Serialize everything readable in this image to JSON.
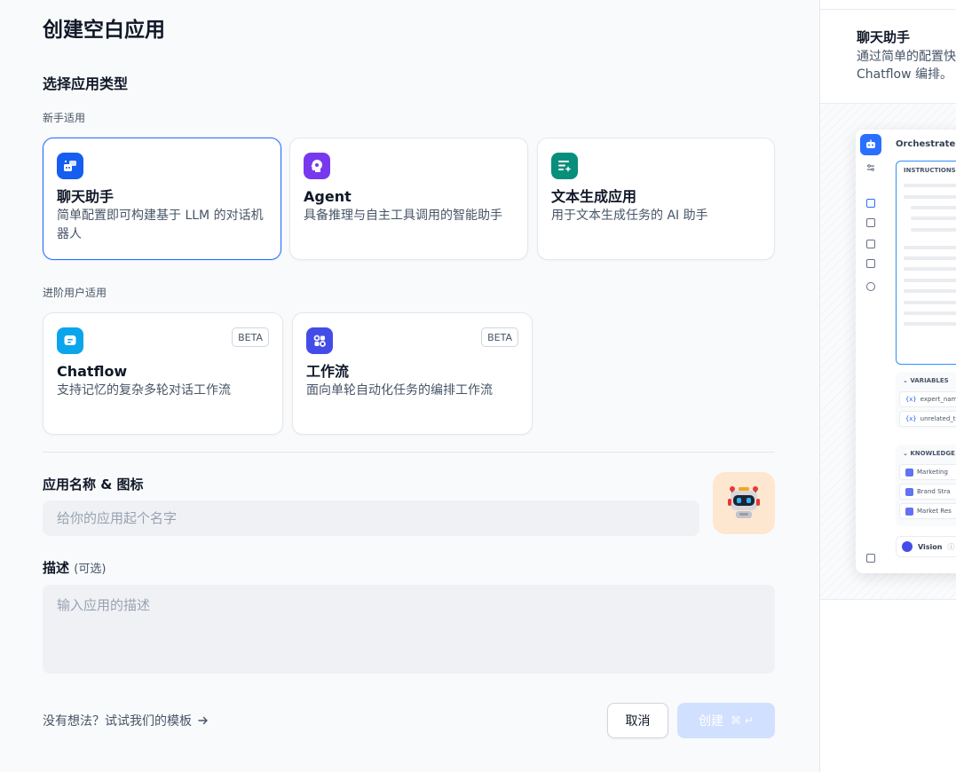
{
  "page": {
    "title": "创建空白应用",
    "section_label": "选择应用类型"
  },
  "groups": {
    "beginner": "新手适用",
    "advanced": "进阶用户适用"
  },
  "cards": {
    "chat_assistant": {
      "title": "聊天助手",
      "desc": "简单配置即可构建基于 LLM 的对话机器人",
      "icon": "chat-bot-icon",
      "color": "#155eef"
    },
    "agent": {
      "title": "Agent",
      "desc": "具备推理与自主工具调用的智能助手",
      "icon": "agent-icon",
      "color": "#7839ee"
    },
    "text_gen": {
      "title": "文本生成应用",
      "desc": "用于文本生成任务的 AI 助手",
      "icon": "text-generation-icon",
      "color": "#088f7b"
    },
    "chatflow": {
      "title": "Chatflow",
      "desc": "支持记忆的复杂多轮对话工作流",
      "badge": "BETA",
      "icon": "chatflow-icon",
      "color": "#0ba5ec"
    },
    "workflow": {
      "title": "工作流",
      "desc": "面向单轮自动化任务的编排工作流",
      "badge": "BETA",
      "icon": "workflow-icon",
      "color": "#444ce7"
    }
  },
  "form": {
    "name_label": "应用名称 & 图标",
    "name_placeholder": "给你的应用起个名字",
    "name_value": "",
    "desc_label": "描述",
    "desc_optional": "(可选)",
    "desc_placeholder": "输入应用的描述",
    "desc_value": "",
    "app_icon": "robot-emoji-icon",
    "app_icon_bg": "#fde7d1"
  },
  "footer": {
    "template_link": "没有想法？试试我们的模板",
    "cancel_label": "取消",
    "create_label": "创建",
    "create_shortcut": "⌘ ↵"
  },
  "preview": {
    "title": "聊天助手",
    "desc_line1": "通过简单的配置快",
    "desc_line2": "Chatflow 编排。",
    "mock": {
      "header": "Orchestrate",
      "instructions_label": "INSTRUCTIONS",
      "variables_label": "VARIABLES",
      "variables": [
        "expert_name",
        "unrelated_t"
      ],
      "knowledge_label": "KNOWLEDGE",
      "knowledge": [
        "Marketing",
        "Brand Stra",
        "Market Res"
      ],
      "vision_label": "Vision"
    }
  }
}
